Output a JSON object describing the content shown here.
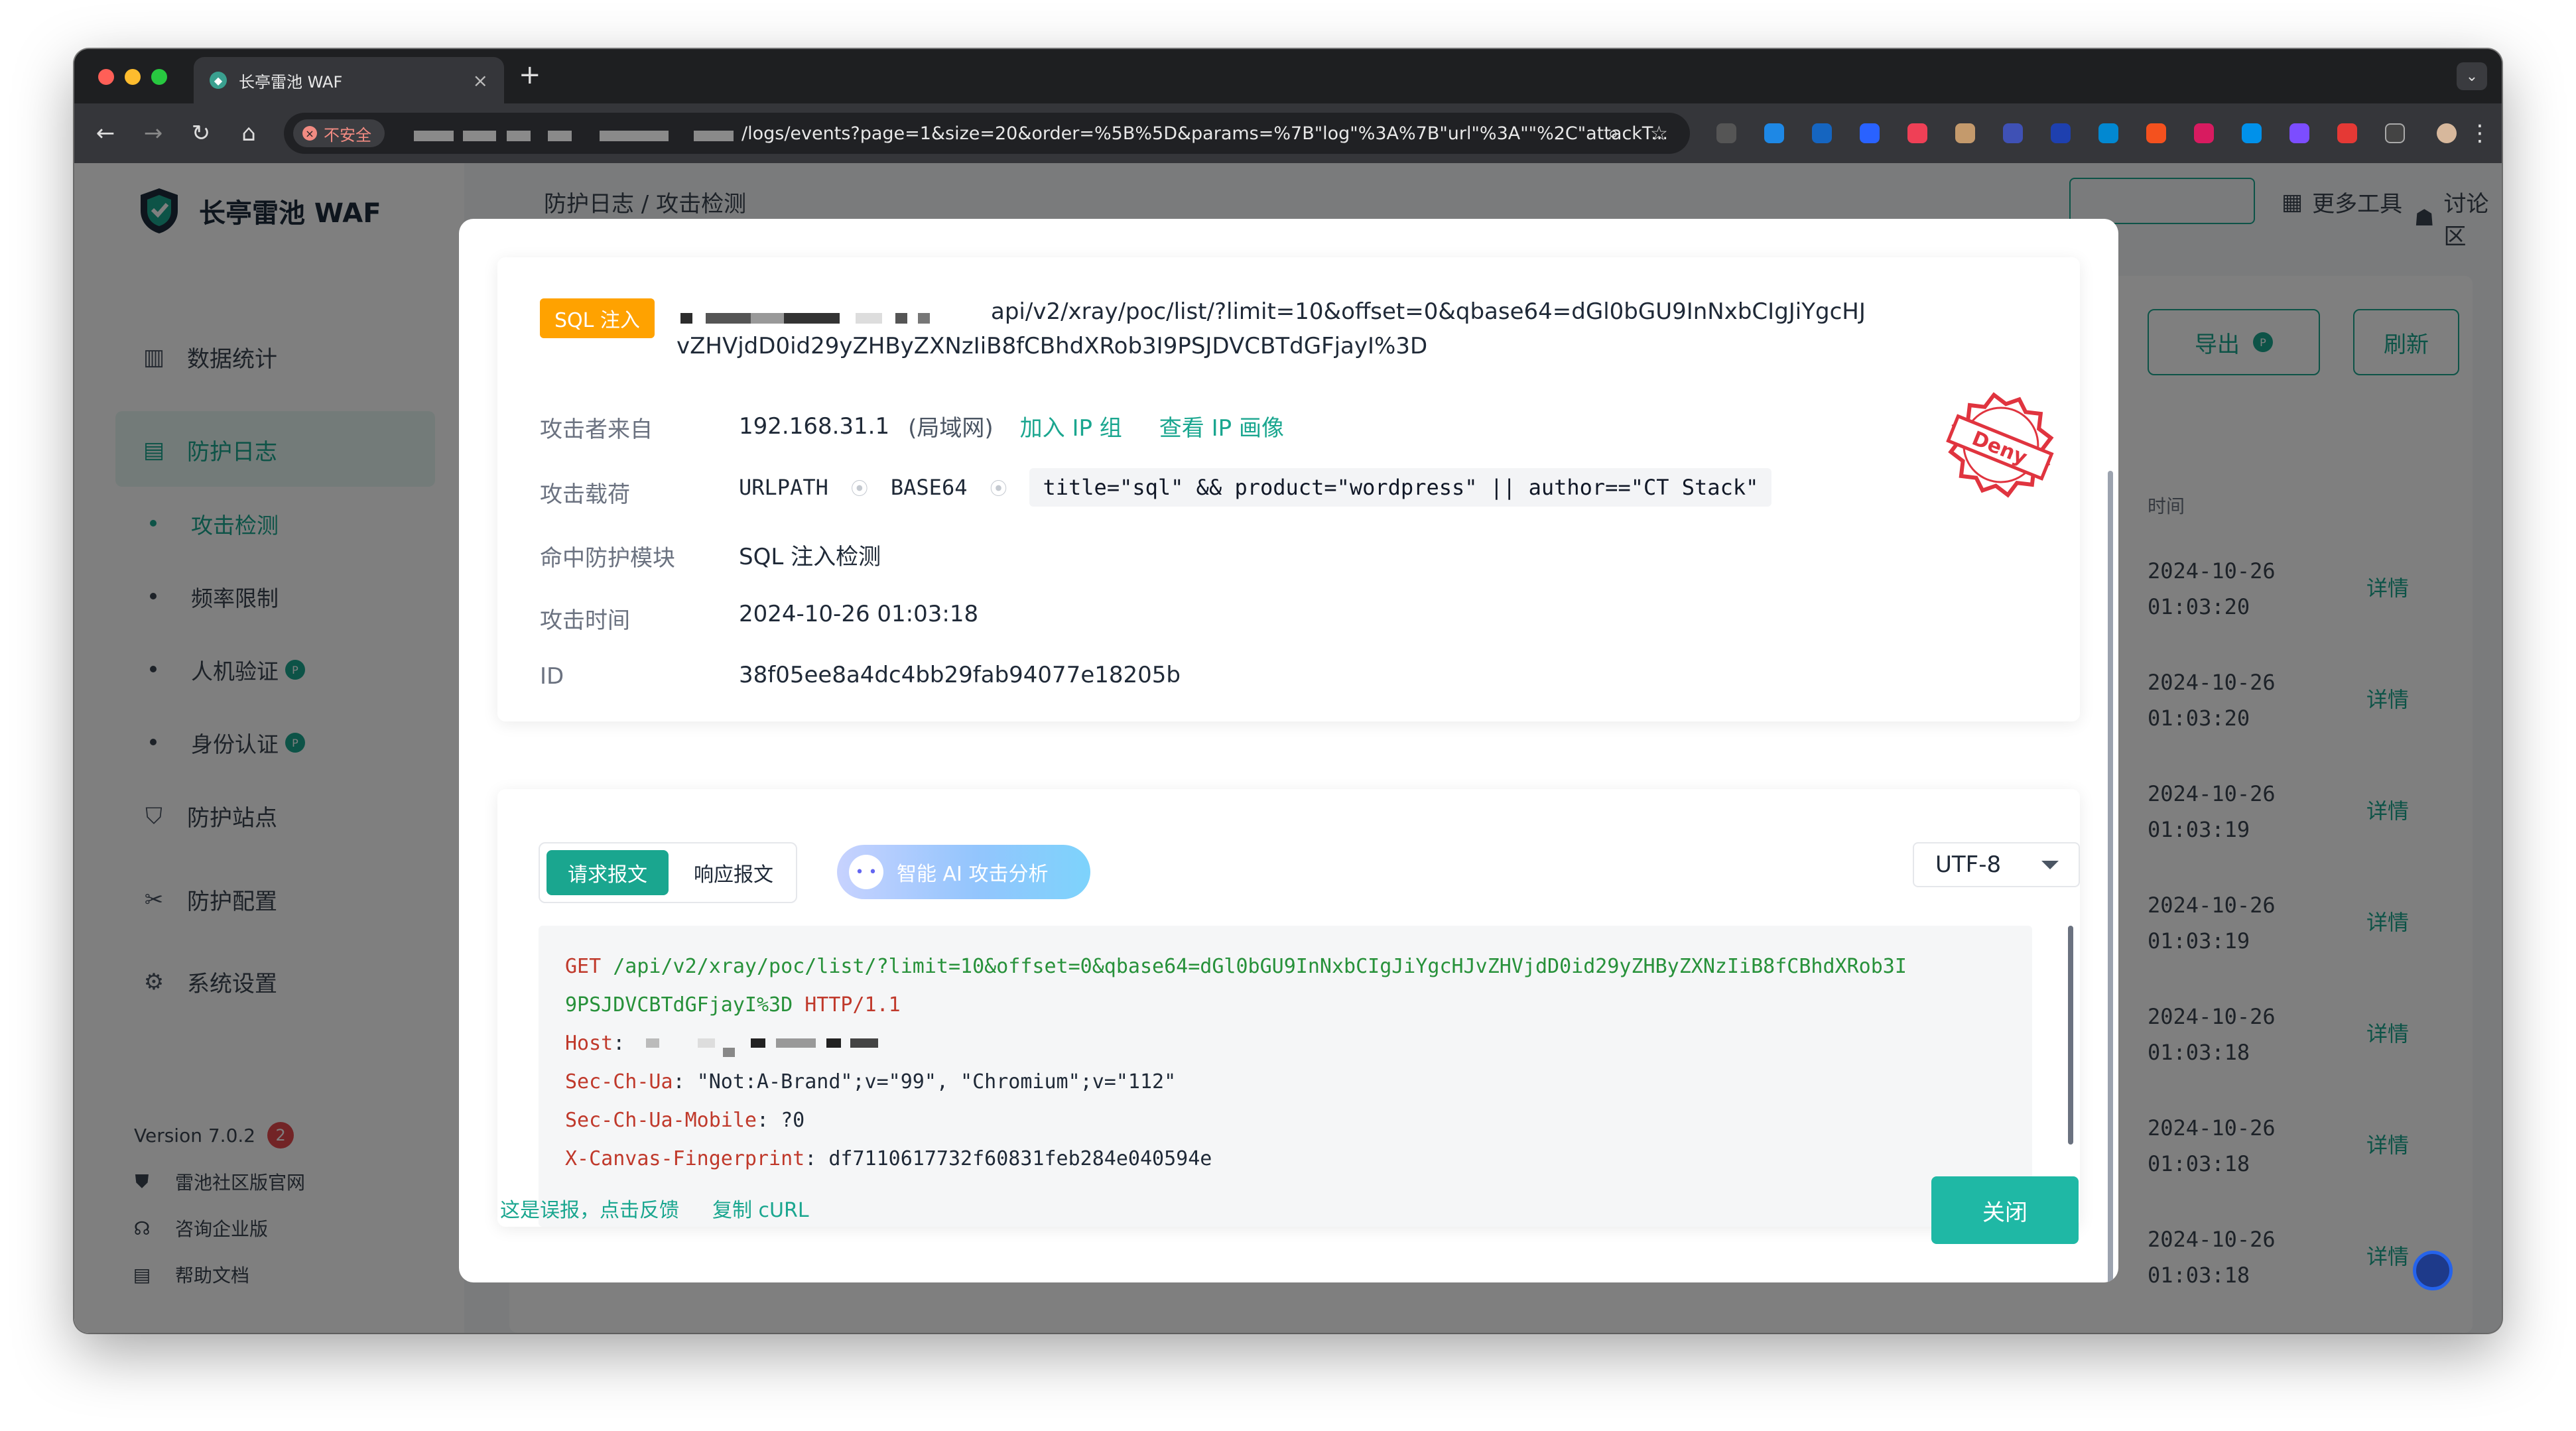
{
  "browser": {
    "tab_title": "长亭雷池 WAF",
    "tab_close": "×",
    "new_tab": "+",
    "security_label": "不安全",
    "url": "/logs/events?page=1&size=20&order=%5B%5D&params=%7B\"log\"%3A%7B\"url\"%3A\"\"%2C\"attackT..."
  },
  "sidebar": {
    "brand": "长亭雷池 WAF",
    "items": [
      {
        "label": "数据统计"
      },
      {
        "label": "防护日志"
      },
      {
        "label": "防护站点"
      },
      {
        "label": "防护配置"
      },
      {
        "label": "系统设置"
      }
    ],
    "sub_items": [
      {
        "label": "攻击检测"
      },
      {
        "label": "频率限制"
      },
      {
        "label": "人机验证"
      },
      {
        "label": "身份认证"
      }
    ],
    "pro_badge": "P",
    "version": "Version 7.0.2",
    "version_badge": "2",
    "footer_links": [
      {
        "label": "雷池社区版官网"
      },
      {
        "label": "咨询企业版"
      },
      {
        "label": "帮助文档"
      }
    ]
  },
  "main": {
    "breadcrumb": "防护日志  /  攻击检测",
    "more_tools": "更多工具",
    "forum": "讨论区",
    "export_label": "导出",
    "refresh_label": "刷新",
    "time_column": "时间",
    "detail_label": "详情",
    "rows": [
      {
        "date": "2024-10-26",
        "time": "01:03:20"
      },
      {
        "date": "2024-10-26",
        "time": "01:03:20"
      },
      {
        "date": "2024-10-26",
        "time": "01:03:19"
      },
      {
        "date": "2024-10-26",
        "time": "01:03:19"
      },
      {
        "date": "2024-10-26",
        "time": "01:03:18"
      },
      {
        "date": "2024-10-26",
        "time": "01:03:18"
      },
      {
        "date": "2024-10-26",
        "time": "01:03:18"
      }
    ]
  },
  "modal": {
    "attack_type": "SQL 注入",
    "attack_url": "api/v2/xray/poc/list/?limit=10&offset=0&qbase64=dGl0bGU9InNxbCIgJiYgcHJvZHVjdD0id29yZHByZXNzIiB8fCBhdXRob3I9PSJDVCBTdGFjayI%3D",
    "labels": {
      "source": "攻击者来自",
      "payload": "攻击载荷",
      "module": "命中防护模块",
      "time": "攻击时间",
      "id": "ID"
    },
    "source_ip": "192.168.31.1",
    "source_region": "(局域网)",
    "add_to_group": "加入 IP 组",
    "view_profile": "查看 IP 画像",
    "payload_parts": [
      "URLPATH",
      "BASE64"
    ],
    "payload_arrow": "⦿",
    "payload_value": "title=\"sql\" && product=\"wordpress\" || author==\"CT Stack\"",
    "module": "SQL 注入检测",
    "time": "2024-10-26 01:03:18",
    "id": "38f05ee8a4dc4bb29fab94077e18205b",
    "stamp_text": "Deny",
    "tab_request": "请求报文",
    "tab_response": "响应报文",
    "ai_button": "智能 AI 攻击分析",
    "encoding": "UTF-8",
    "code": {
      "method": "GET",
      "path_line1": "/api/v2/xray/poc/list/?limit=10&offset=0&qbase64=dGl0bGU9InNxbCIgJiYgcHJvZHVjdD0id29yZHByZXNzIiB8fCBhdXRob3I",
      "path_line2": "9PSJDVCBTdGFjayI%3D",
      "protocol": "HTTP/1.1",
      "headers": [
        {
          "name": "Host",
          "value": ""
        },
        {
          "name": "Sec-Ch-Ua",
          "value": "\"Not:A-Brand\";v=\"99\", \"Chromium\";v=\"112\""
        },
        {
          "name": "Sec-Ch-Ua-Mobile",
          "value": "?0"
        },
        {
          "name": "X-Canvas-Fingerprint",
          "value": "df7110617732f60831feb284e040594e"
        }
      ]
    },
    "feedback_link": "这是误报，点击反馈",
    "copy_curl": "复制 cURL",
    "close_button": "关闭"
  },
  "colors": {
    "accent": "#1aa68f",
    "close_button": "#1fb8a5",
    "sql_tag": "#ffa200",
    "stamp": "#e0343f",
    "code_keyword": "#c0392b",
    "code_path": "#27913a"
  }
}
